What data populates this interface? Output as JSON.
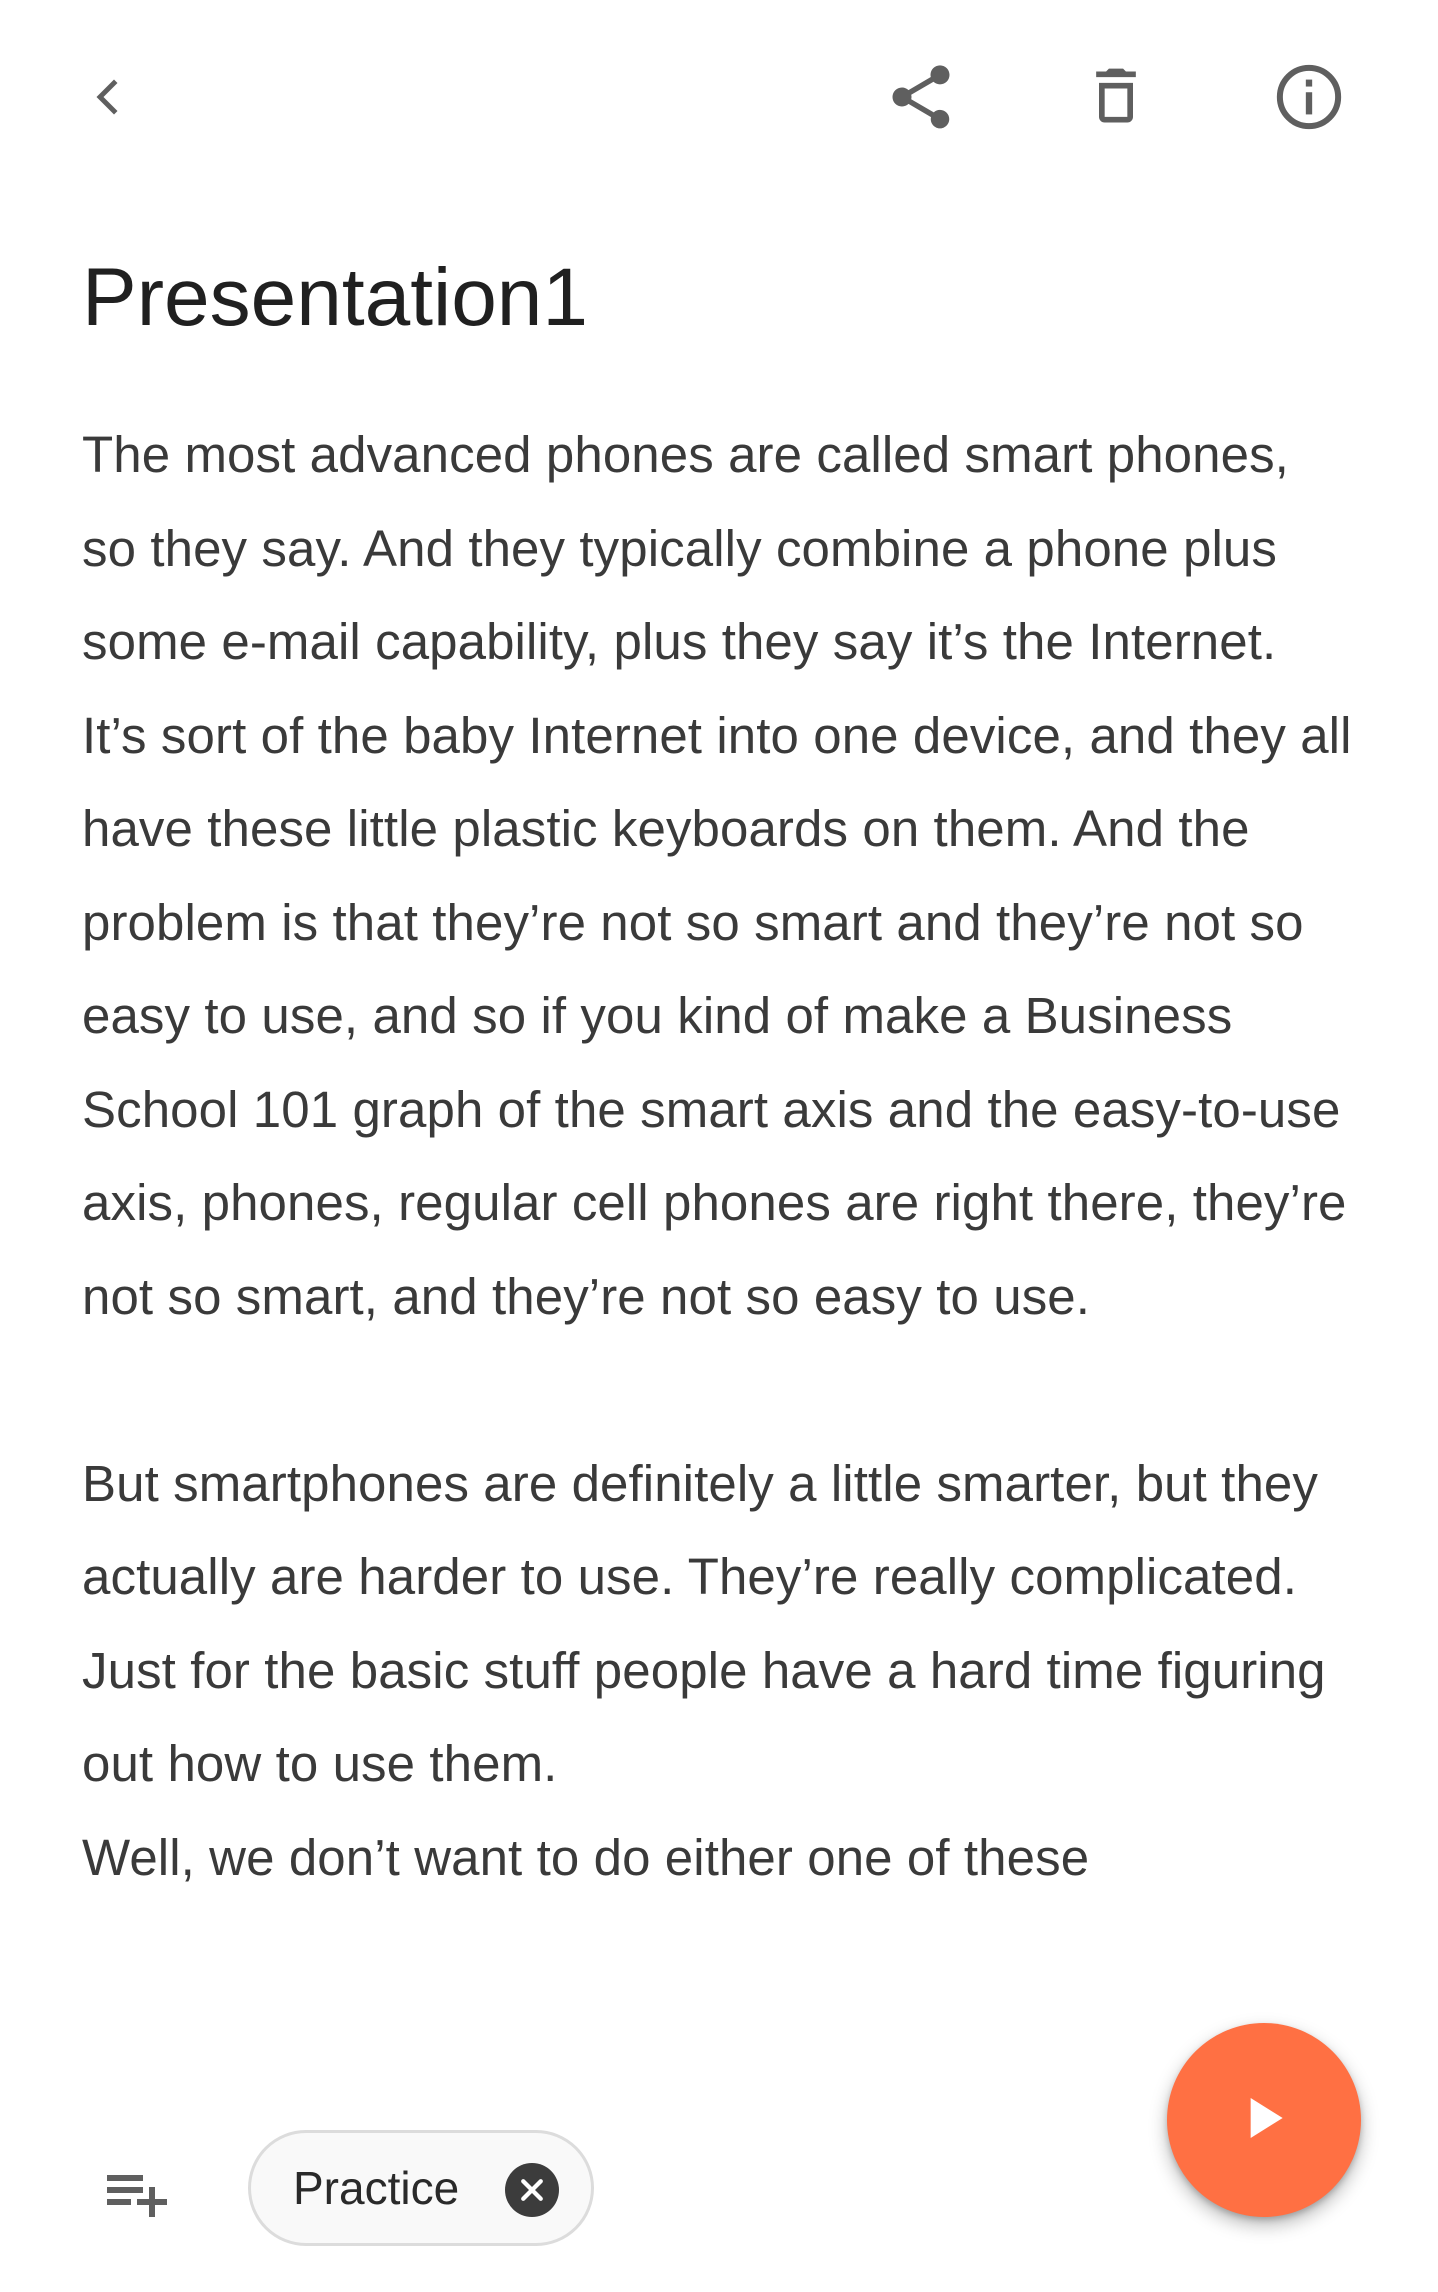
{
  "header": {
    "back_icon": "arrow-back-icon",
    "share_icon": "share-icon",
    "delete_icon": "delete-icon",
    "info_icon": "info-icon"
  },
  "document": {
    "title": "Presentation1",
    "paragraphs": [
      "The most advanced phones are called smart phones, so they say. And they typically combine a phone plus some e-mail capability, plus they say it’s the Internet.",
      "It’s sort of the baby Internet into one device, and they all have these little plastic keyboards on them. And the problem is that they’re not so smart and they’re not so easy to use, and so if you kind of make a Business School 101 graph of the smart axis and the easy-to-use axis, phones, regular cell phones are right there, they’re not so smart, and they’re not so easy to use.",
      "But smartphones are definitely a little smarter, but they actually are harder to use. They’re really complicated. Just for the basic stuff people have a hard time figuring out how to use them.",
      "Well, we don’t want to do either one of these"
    ]
  },
  "bottom_bar": {
    "add_to_list_icon": "playlist-add-icon",
    "chip_label": "Practice",
    "chip_close_icon": "close-circle-icon",
    "fab_icon": "play-icon"
  },
  "colors": {
    "accent": "#ff7043",
    "text": "#3a3a3a",
    "icon": "#5f5f5f"
  }
}
